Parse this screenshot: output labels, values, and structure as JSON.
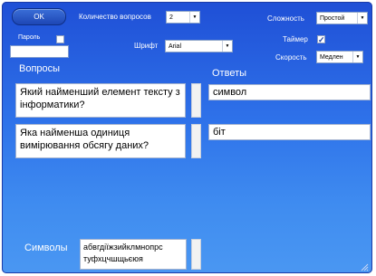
{
  "toolbar": {
    "ok_label": "OK",
    "question_count_label": "Количество вопросов",
    "question_count_value": "2",
    "password_label": "Пароль",
    "password_value": "",
    "font_label": "Шрифт",
    "font_value": "Arial",
    "difficulty_label": "Сложность",
    "difficulty_value": "Простой",
    "timer_label": "Таймер",
    "timer_checked": true,
    "speed_label": "Скорость",
    "speed_value": "Медлен"
  },
  "sections": {
    "questions_heading": "Вопросы",
    "answers_heading": "Ответы",
    "symbols_label": "Символы"
  },
  "questions": [
    {
      "text": "Який найменший елемент тексту з інформатики?",
      "answer": "символ"
    },
    {
      "text": "Яка найменша одиниця вимірювання обсягу даних?",
      "answer": "біт"
    }
  ],
  "symbols_value": "абвгдіїжзийклмнопрс туфхцчшщьєюя",
  "icons": {
    "dropdown": "chevron-down-icon",
    "checkmark": "check-icon",
    "resize": "resize-grip-icon"
  }
}
